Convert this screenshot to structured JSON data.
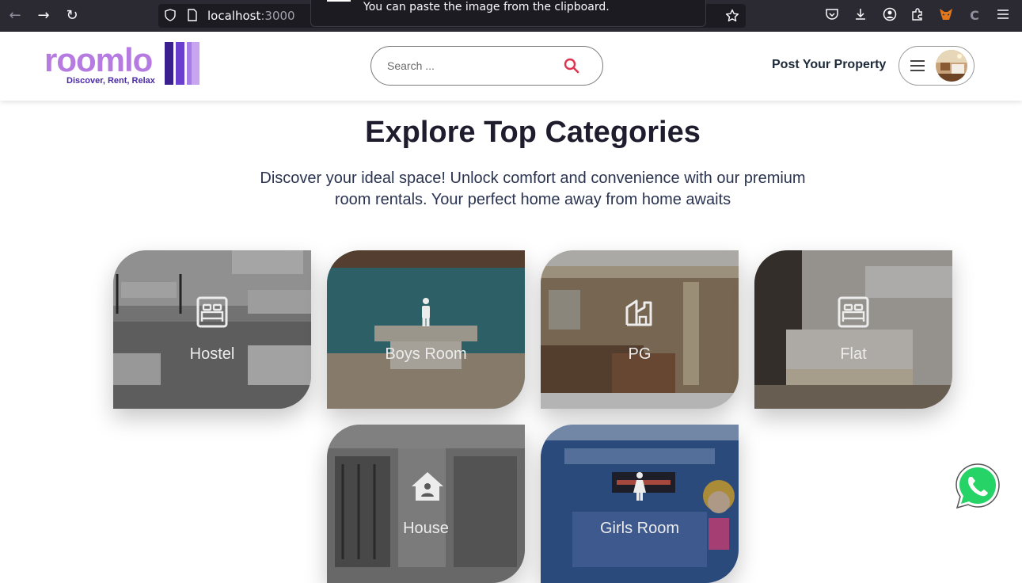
{
  "browser": {
    "url_host": "localhost",
    "url_port": ":3000",
    "tooltip": "You can paste the image from the clipboard.",
    "icons": [
      "back-icon",
      "forward-icon",
      "reload-icon",
      "shield-icon",
      "page-icon",
      "bookmark-star-icon",
      "pocket-icon",
      "download-icon",
      "account-icon",
      "extensions-icon",
      "metamask-icon",
      "extension-c-icon",
      "menu-icon"
    ]
  },
  "header": {
    "logo_word": "roomlo",
    "logo_tagline": "Discover, Rent, Relax",
    "search_placeholder": "Search ...",
    "post_property": "Post Your Property"
  },
  "main": {
    "title": "Explore Top Categories",
    "subtitle": "Discover your ideal space! Unlock comfort and convenience with our premium room rentals. Your perfect home away from home awaits",
    "categories": [
      {
        "label": "Hostel",
        "icon": "bed-icon"
      },
      {
        "label": "Boys Room",
        "icon": "male-icon"
      },
      {
        "label": "PG",
        "icon": "building-icon"
      },
      {
        "label": "Flat",
        "icon": "bed-icon"
      },
      {
        "label": "House",
        "icon": "house-user-icon"
      },
      {
        "label": "Girls Room",
        "icon": "female-icon"
      }
    ]
  },
  "colors": {
    "brand_purple": "#b57be0",
    "brand_dark": "#4a2aa8",
    "search_accent": "#e0334f",
    "whatsapp_green": "#25d366"
  }
}
